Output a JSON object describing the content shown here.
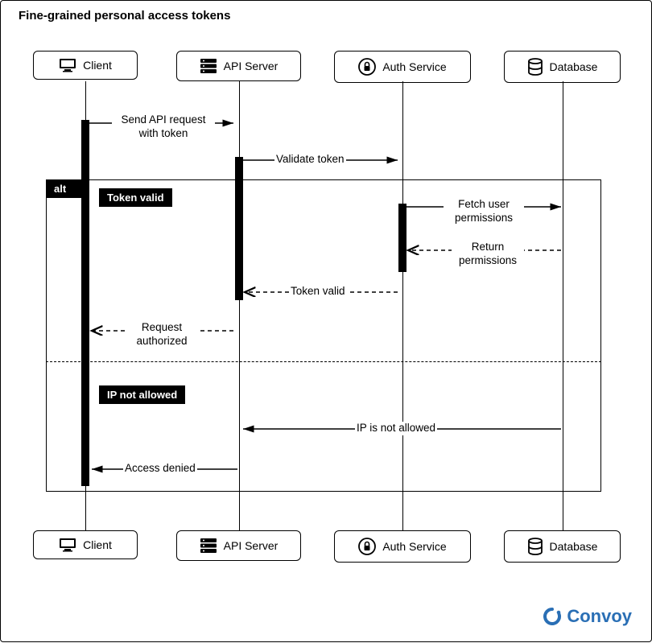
{
  "title": "Fine-grained personal access tokens",
  "participants": {
    "client": "Client",
    "api": "API Server",
    "auth": "Auth Service",
    "db": "Database"
  },
  "alt": {
    "tab": "alt",
    "branch_valid": "Token valid",
    "branch_invalid": "IP not allowed"
  },
  "messages": {
    "send_request_l1": "Send API request",
    "send_request_l2": "with token",
    "validate_token": "Validate token",
    "fetch_perm_l1": "Fetch user",
    "fetch_perm_l2": "permissions",
    "return_perm_l1": "Return",
    "return_perm_l2": "permissions",
    "token_valid": "Token valid",
    "request_auth_l1": "Request",
    "request_auth_l2": "authorized",
    "ip_not_allowed": "IP is not allowed",
    "access_denied": "Access denied"
  },
  "brand": "Convoy"
}
